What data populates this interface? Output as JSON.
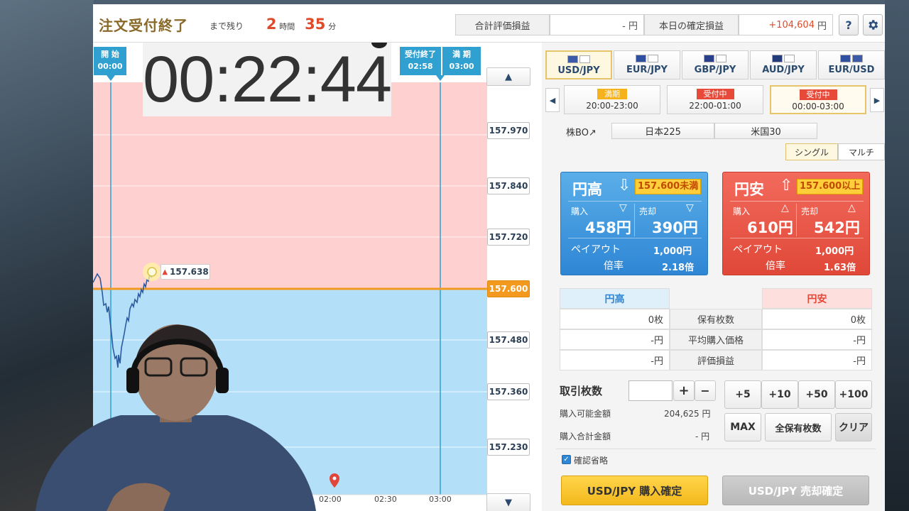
{
  "header": {
    "title": "注文受付終了",
    "remaining_label": "まで残り",
    "hours": "2",
    "hours_unit": "時間",
    "minutes": "35",
    "minutes_unit": "分",
    "total_pl_label": "合計評価損益",
    "total_pl_value": "- 円",
    "today_pl_label": "本日の確定損益",
    "today_pl_value": "+104,604",
    "today_pl_unit": "円",
    "help_label": "?",
    "settings_icon": "gear-icon"
  },
  "chart": {
    "timer": "00:22:44",
    "start_marker": {
      "label": "開 始",
      "time": "00:00"
    },
    "end_accept_marker": {
      "label": "受付終了",
      "time": "02:58"
    },
    "expiry_marker": {
      "label": "満 期",
      "time": "03:00"
    },
    "current_price_tag": "157.638",
    "current_price_label": "157.600",
    "y_labels": [
      "157.970",
      "157.840",
      "157.720",
      "157.480",
      "157.360",
      "157.230"
    ],
    "x_labels": [
      "02:00",
      "02:30",
      "03:00"
    ],
    "colors": {
      "upper_zone": "#ffd0d0",
      "lower_zone": "#b3e0f8",
      "strike_line": "#f39a1e",
      "price_line": "#2b5aa0",
      "marker": "#2fa0cf"
    }
  },
  "panel": {
    "pairs": [
      {
        "label": "USD/JPY",
        "flags": [
          "#3c5aa8",
          "#ffffff"
        ],
        "selected": true
      },
      {
        "label": "EUR/JPY",
        "flags": [
          "#2f4fa0",
          "#ffffff"
        ],
        "selected": false
      },
      {
        "label": "GBP/JPY",
        "flags": [
          "#2a3f8a",
          "#ffffff"
        ],
        "selected": false
      },
      {
        "label": "AUD/JPY",
        "flags": [
          "#243b7a",
          "#ffffff"
        ],
        "selected": false
      },
      {
        "label": "EUR/USD",
        "flags": [
          "#2f4fa0",
          "#3c5aa8"
        ],
        "selected": false
      }
    ],
    "slots": [
      {
        "badge": "満期",
        "time": "20:00-23:00",
        "badge_color": "#f5b21a"
      },
      {
        "badge": "受付中",
        "time": "22:00-01:00",
        "badge_color": "#e84a3a"
      },
      {
        "badge": "受付中",
        "time": "00:00-03:00",
        "badge_color": "#e84a3a"
      }
    ],
    "stock_bo_label": "株BO↗",
    "stock_items": [
      "日本225",
      "米国30"
    ],
    "modes": [
      "シングル",
      "マルチ"
    ],
    "cards": {
      "blue": {
        "title": "円高",
        "condition": "157.600未満",
        "buy_label": "購入",
        "sell_label": "売却",
        "buy_price": "458円",
        "sell_price": "390円",
        "payout_label": "ペイアウト",
        "payout_value": "1,000円",
        "rate_label": "倍率",
        "rate_value": "2.18倍"
      },
      "red": {
        "title": "円安",
        "condition": "157.600以上",
        "buy_label": "購入",
        "sell_label": "売却",
        "buy_price": "610円",
        "sell_price": "542円",
        "payout_label": "ペイアウト",
        "payout_value": "1,000円",
        "rate_label": "倍率",
        "rate_value": "1.63倍"
      }
    },
    "holdings": {
      "header_left": "円高",
      "header_right": "円安",
      "rows": [
        {
          "label": "保有枚数",
          "left": "0枚",
          "right": "0枚"
        },
        {
          "label": "平均購入価格",
          "left": "-円",
          "right": "-円"
        },
        {
          "label": "評価損益",
          "left": "-円",
          "right": "-円"
        }
      ]
    },
    "trade": {
      "qty_label": "取引枚数",
      "qty_value": "",
      "plus": "+",
      "minus": "−",
      "available_label": "購入可能金額",
      "available_value": "204,625 円",
      "total_label": "購入合計金額",
      "total_value": "- 円",
      "quick": [
        "+5",
        "+10",
        "+50",
        "+100"
      ],
      "max_label": "MAX",
      "all_label": "全保有枚数",
      "clear_label": "クリア",
      "skip_confirm_label": "確認省略",
      "buy_confirm": "USD/JPY 購入確定",
      "sell_confirm": "USD/JPY 売却確定"
    }
  }
}
